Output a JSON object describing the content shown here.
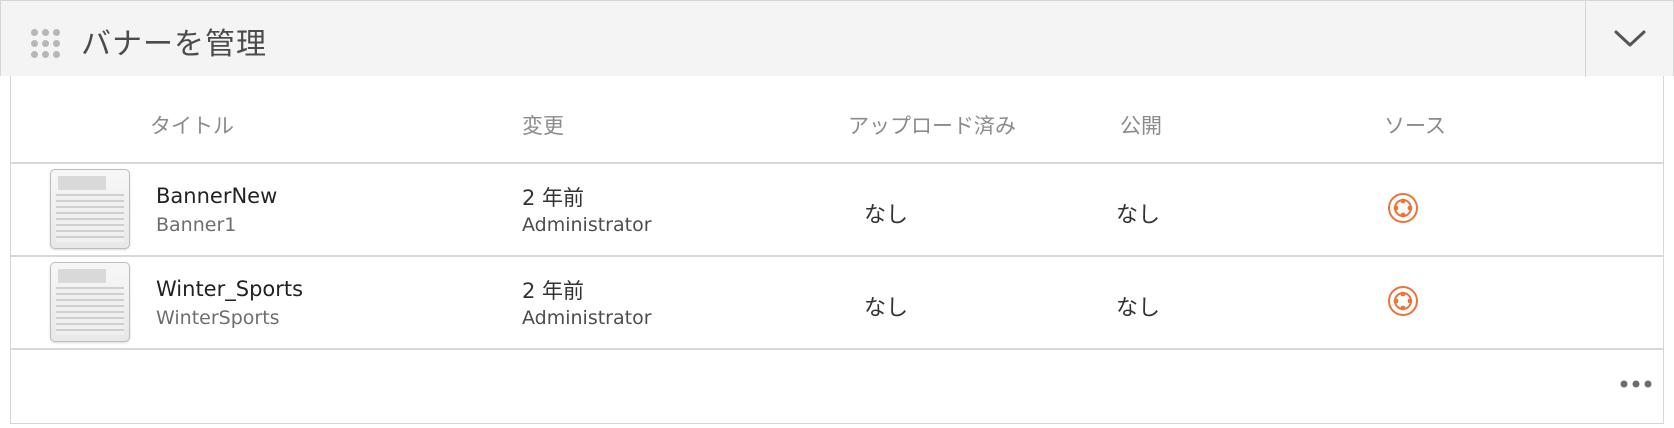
{
  "header": {
    "title": "バナーを管理",
    "drag_icon": "drag-grip-icon",
    "collapse_icon": "chevron-down-icon"
  },
  "columns": {
    "title": "タイトル",
    "modified": "変更",
    "uploaded": "アップロード済み",
    "published": "公開",
    "source": "ソース"
  },
  "rows": [
    {
      "title": "BannerNew",
      "name": "Banner1",
      "modified_time": "2 年前",
      "modified_by": "Administrator",
      "uploaded": "なし",
      "published": "なし",
      "source_icon": "source-badge-icon"
    },
    {
      "title": "Winter_Sports",
      "name": "WinterSports",
      "modified_time": "2 年前",
      "modified_by": "Administrator",
      "uploaded": "なし",
      "published": "なし",
      "source_icon": "source-badge-icon"
    }
  ],
  "footer": {
    "more_icon": "more-ellipsis-icon"
  },
  "colors": {
    "source_accent": "#e8753a",
    "header_bg": "#f4f4f4",
    "border": "#d6d6d6"
  }
}
